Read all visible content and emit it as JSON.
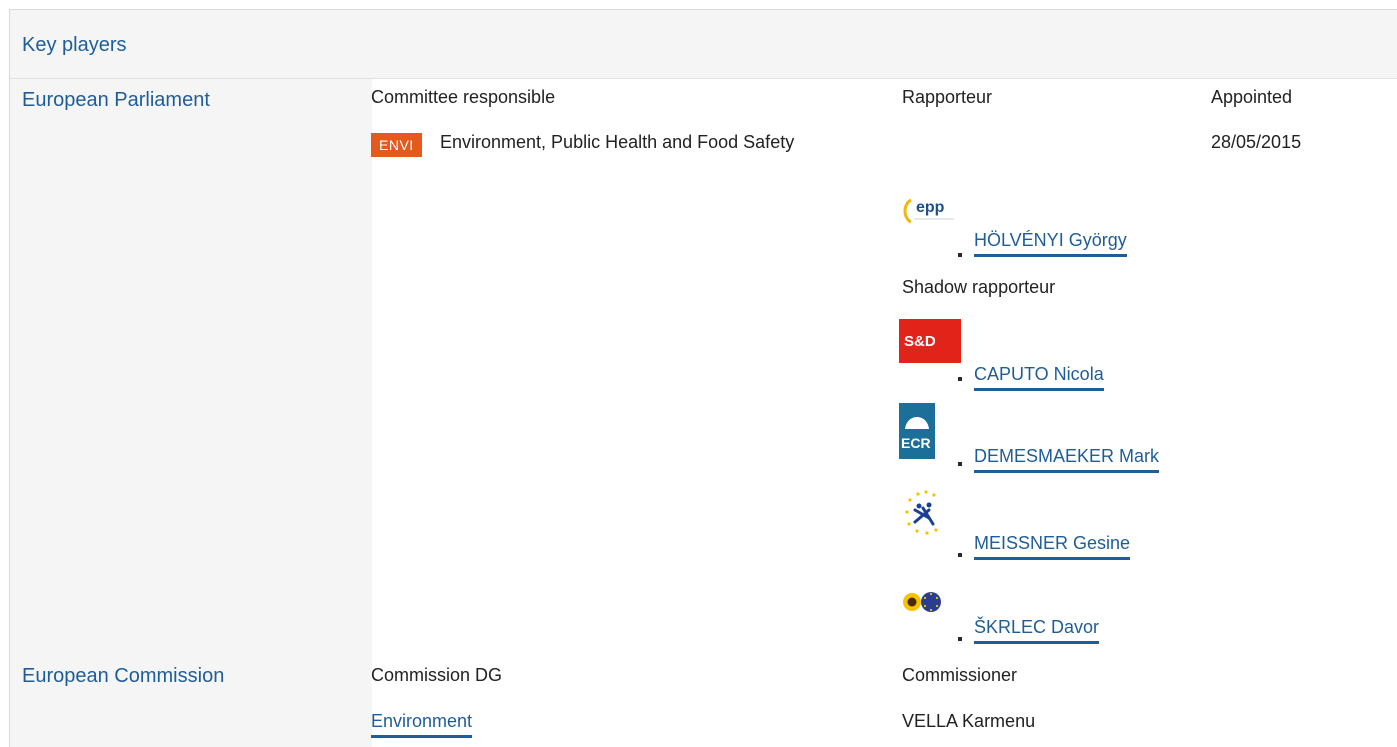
{
  "header": {
    "title": "Key players"
  },
  "parliament": {
    "institution": "European Parliament",
    "col_committee": "Committee responsible",
    "col_rapporteur": "Rapporteur",
    "col_appointed": "Appointed",
    "committee_code": "ENVI",
    "committee_name": "Environment, Public Health and Food Safety",
    "appointed_date": "28/05/2015",
    "rapporteur": {
      "group_logo": "epp-logo",
      "name": "HÖLVÉNYI György"
    },
    "shadow_label": "Shadow rapporteur",
    "shadows": [
      {
        "group_logo": "sd-logo",
        "name": "CAPUTO Nicola"
      },
      {
        "group_logo": "ecr-logo",
        "name": "DEMESMAEKER Mark"
      },
      {
        "group_logo": "efdd-logo",
        "name": "MEISSNER Gesine"
      },
      {
        "group_logo": "greens-efa-logo",
        "name": "ŠKRLEC Davor"
      }
    ],
    "logo_text": {
      "epp": "epp",
      "sd": "S&D",
      "ecr": "ECR"
    }
  },
  "commission": {
    "institution": "European Commission",
    "col_dg": "Commission DG",
    "col_commissioner": "Commissioner",
    "dg": "Environment",
    "commissioner": "VELLA Karmenu"
  },
  "colors": {
    "accent": "#1f5d98",
    "badge": "#e35a1c",
    "panel": "#f5f5f5"
  }
}
